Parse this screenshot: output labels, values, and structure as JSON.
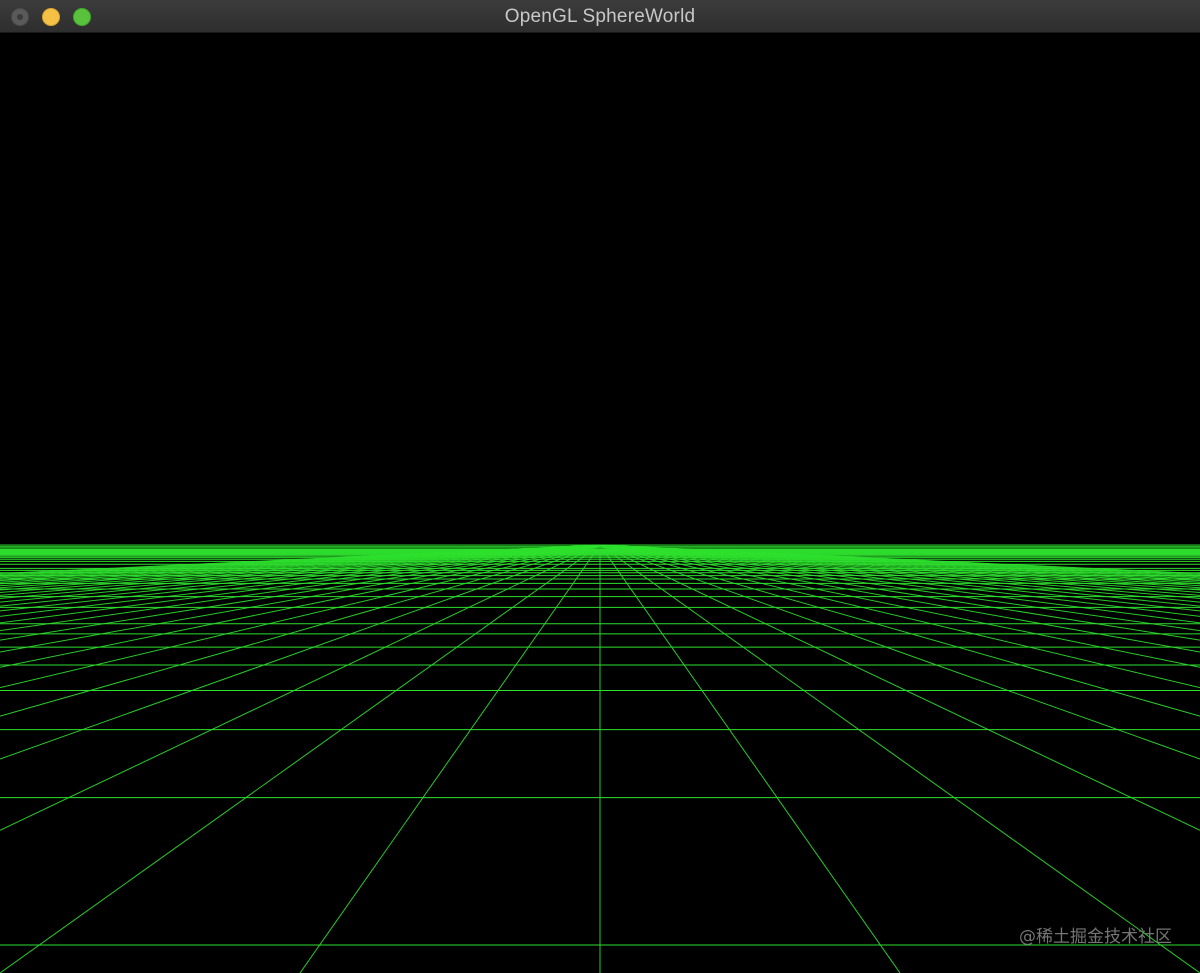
{
  "window": {
    "title": "OpenGL SphereWorld"
  },
  "traffic_lights": {
    "close_color": "#5a5a5a",
    "minimize_color": "#f4c045",
    "zoom_color": "#58c23c"
  },
  "scene": {
    "background_color": "#000000",
    "grid_color": "#2ee02e",
    "description": "wireframe floor grid"
  },
  "watermark": {
    "text": "@稀土掘金技术社区"
  }
}
